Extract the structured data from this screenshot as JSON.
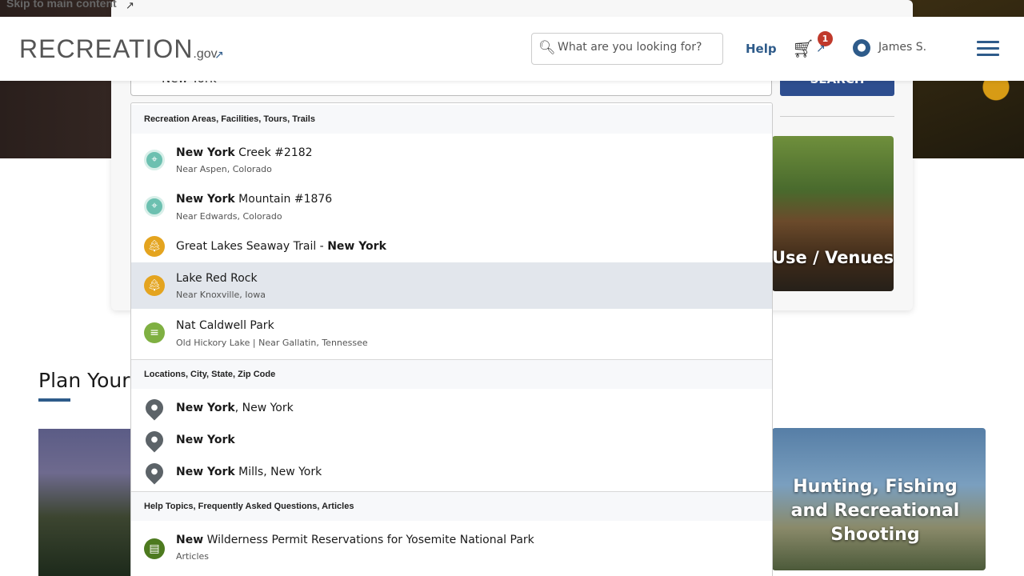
{
  "skip_link": "Skip to main content",
  "header": {
    "logo_text": "RECREATION",
    "logo_suffix": ".gov",
    "search_placeholder": "What are you looking for?",
    "help_label": "Help",
    "cart_count": "1",
    "user_name": "James S."
  },
  "behind": {
    "search_value": "New York",
    "search_button": "SEARCH",
    "venue_label": "Use / Venues",
    "plan_title": "Plan Your",
    "hunting_label": "Hunting, Fishing and Recreational Shooting"
  },
  "dropdown": {
    "sections": [
      {
        "header": "Recreation Areas, Facilities, Tours, Trails",
        "items": [
          {
            "icon": "compass-icon",
            "bold": "New York",
            "rest": " Creek #2182",
            "sub": "Near Aspen, Colorado"
          },
          {
            "icon": "compass-icon",
            "bold": "New York",
            "rest": " Mountain #1876",
            "sub": "Near Edwards, Colorado"
          },
          {
            "icon": "tree-icon",
            "pre": "Great Lakes Seaway Trail - ",
            "bold": "New York",
            "sub": ""
          },
          {
            "icon": "tree-icon",
            "plain": "Lake Red Rock",
            "sub": "Near Knoxville, Iowa"
          },
          {
            "icon": "picnic-icon",
            "plain": "Nat Caldwell Park",
            "sub": "Old Hickory Lake | Near Gallatin, Tennessee"
          }
        ]
      },
      {
        "header": "Locations, City, State, Zip Code",
        "items": [
          {
            "icon": "map-pin-icon",
            "bold": "New York",
            "rest": ", New York"
          },
          {
            "icon": "map-pin-icon",
            "bold": "New York",
            "rest": ""
          },
          {
            "icon": "map-pin-icon",
            "bold": "New York",
            "rest": " Mills, New York"
          }
        ]
      },
      {
        "header": "Help Topics, Frequently Asked Questions, Articles",
        "items": [
          {
            "icon": "document-icon",
            "bold": "New",
            "rest": " Wilderness Permit Reservations for Yosemite National Park",
            "sub": "Articles"
          }
        ]
      }
    ]
  }
}
